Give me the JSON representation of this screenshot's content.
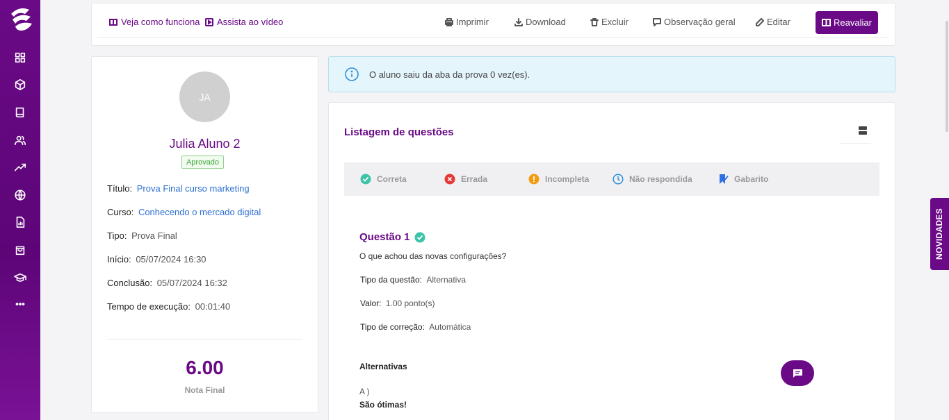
{
  "sidebar": {
    "logo": "app-logo",
    "items": [
      {
        "icon": "grid-icon"
      },
      {
        "icon": "cube-icon"
      },
      {
        "icon": "book-icon"
      },
      {
        "icon": "users-icon"
      },
      {
        "icon": "trending-up-icon"
      },
      {
        "icon": "globe-icon"
      },
      {
        "icon": "report-icon"
      },
      {
        "icon": "bag-icon"
      },
      {
        "icon": "graduation-cap-icon"
      },
      {
        "icon": "more-icon"
      }
    ]
  },
  "topbar": {
    "help_link": "Veja como funciona",
    "video_link": "Assista ao vídeo",
    "print": "Imprimir",
    "download": "Download",
    "delete": "Excluir",
    "note": "Observação geral",
    "edit": "Editar",
    "reevaluate": "Reavaliar"
  },
  "student": {
    "initials": "JA",
    "name": "Julia Aluno 2",
    "status": "Aprovado",
    "fields": {
      "title_label": "Título",
      "title_value": "Prova Final curso marketing",
      "course_label": "Curso",
      "course_value": "Conhecendo o mercado digital",
      "type_label": "Tipo",
      "type_value": "Prova Final",
      "start_label": "Início",
      "start_value": "05/07/2024 16:30",
      "end_label": "Conclusão",
      "end_value": "05/07/2024 16:32",
      "duration_label": "Tempo de execução",
      "duration_value": "00:01:40"
    },
    "grade": "6.00",
    "grade_label": "Nota Final"
  },
  "alert": {
    "text": "O aluno saiu da aba da prova 0 vez(es)."
  },
  "questions": {
    "title": "Listagem de questões",
    "legend": {
      "correct": "Correta",
      "wrong": "Errada",
      "incomplete": "Incompleta",
      "unanswered": "Não respondida",
      "answer_key": "Gabarito"
    },
    "item": {
      "heading": "Questão 1",
      "text": "O que achou das novas configurações?",
      "type_label": "Tipo da questão",
      "type_value": "Alternativa",
      "value_label": "Valor",
      "value_value": "1.00 ponto(s)",
      "correction_label": "Tipo de correção",
      "correction_value": "Automática",
      "alternatives_title": "Alternativas",
      "alt_letter": "A )",
      "alt_text": "São ótimas!"
    }
  },
  "novidades": "NOVIDADES",
  "colors": {
    "brand": "#6a0a86",
    "link": "#2d6fd2",
    "correct": "#3cc4a8",
    "wrong": "#e53935",
    "incomplete": "#f39c12",
    "unanswered": "#2f8fd8"
  }
}
